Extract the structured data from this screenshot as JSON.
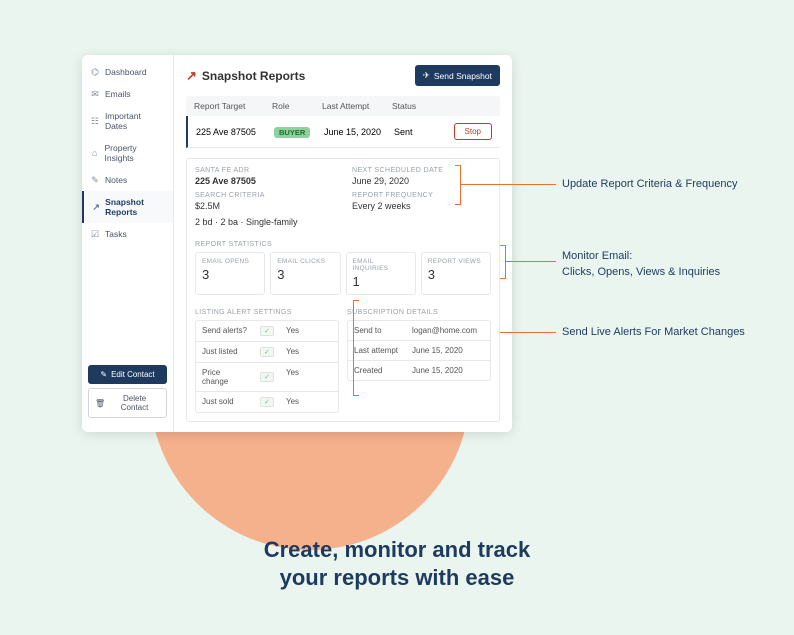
{
  "sidebar": {
    "items": [
      {
        "icon": "⌬",
        "label": "Dashboard"
      },
      {
        "icon": "✉",
        "label": "Emails"
      },
      {
        "icon": "☷",
        "label": "Important Dates"
      },
      {
        "icon": "⌂",
        "label": "Property Insights"
      },
      {
        "icon": "✎",
        "label": "Notes"
      },
      {
        "icon": "↗",
        "label": "Snapshot Reports"
      },
      {
        "icon": "☑",
        "label": "Tasks"
      }
    ],
    "edit_label": "Edit Contact",
    "delete_label": "Delete Contact"
  },
  "header": {
    "title": "Snapshot Reports",
    "send_button": "Send Snapshot"
  },
  "table": {
    "columns": {
      "target": "Report Target",
      "role": "Role",
      "attempt": "Last Attempt",
      "status": "Status"
    },
    "row": {
      "target": "225 Ave 87505",
      "role": "BUYER",
      "attempt": "June 15, 2020",
      "status": "Sent",
      "action": "Stop"
    }
  },
  "detail": {
    "address_label": "SANTA FE ADR",
    "address": "225 Ave 87505",
    "criteria_label": "SEARCH CRITERIA",
    "price": "$2.5M",
    "criteria": "2 bd · 2 ba · Single-family",
    "next_label": "NEXT SCHEDULED DATE",
    "next_date": "June 29, 2020",
    "freq_label": "REPORT FREQUENCY",
    "freq": "Every 2 weeks"
  },
  "stats": {
    "section_label": "REPORT STATISTICS",
    "items": [
      {
        "label": "EMAIL OPENS",
        "value": "3"
      },
      {
        "label": "EMAIL CLICKS",
        "value": "3"
      },
      {
        "label": "EMAIL INQUIRIES",
        "value": "1"
      },
      {
        "label": "REPORT VIEWS",
        "value": "3"
      }
    ]
  },
  "alerts": {
    "section_label": "LISTING ALERT SETTINGS",
    "rows": [
      {
        "k": "Send alerts?",
        "v": "Yes"
      },
      {
        "k": "Just listed",
        "v": "Yes"
      },
      {
        "k": "Price change",
        "v": "Yes"
      },
      {
        "k": "Just sold",
        "v": "Yes"
      }
    ]
  },
  "subscription": {
    "section_label": "SUBSCRIPTION DETAILS",
    "rows": [
      {
        "k": "Send to",
        "v": "logan@home.com"
      },
      {
        "k": "Last attempt",
        "v": "June 15, 2020"
      },
      {
        "k": "Created",
        "v": "June 15, 2020"
      }
    ]
  },
  "callouts": {
    "c1": "Update Report Criteria & Frequency",
    "c2a": "Monitor Email:",
    "c2b": "Clicks, Opens, Views & Inquiries",
    "c3": "Send Live Alerts For Market Changes"
  },
  "tagline": {
    "line1": "Create, monitor and track",
    "line2": "your reports with ease"
  }
}
